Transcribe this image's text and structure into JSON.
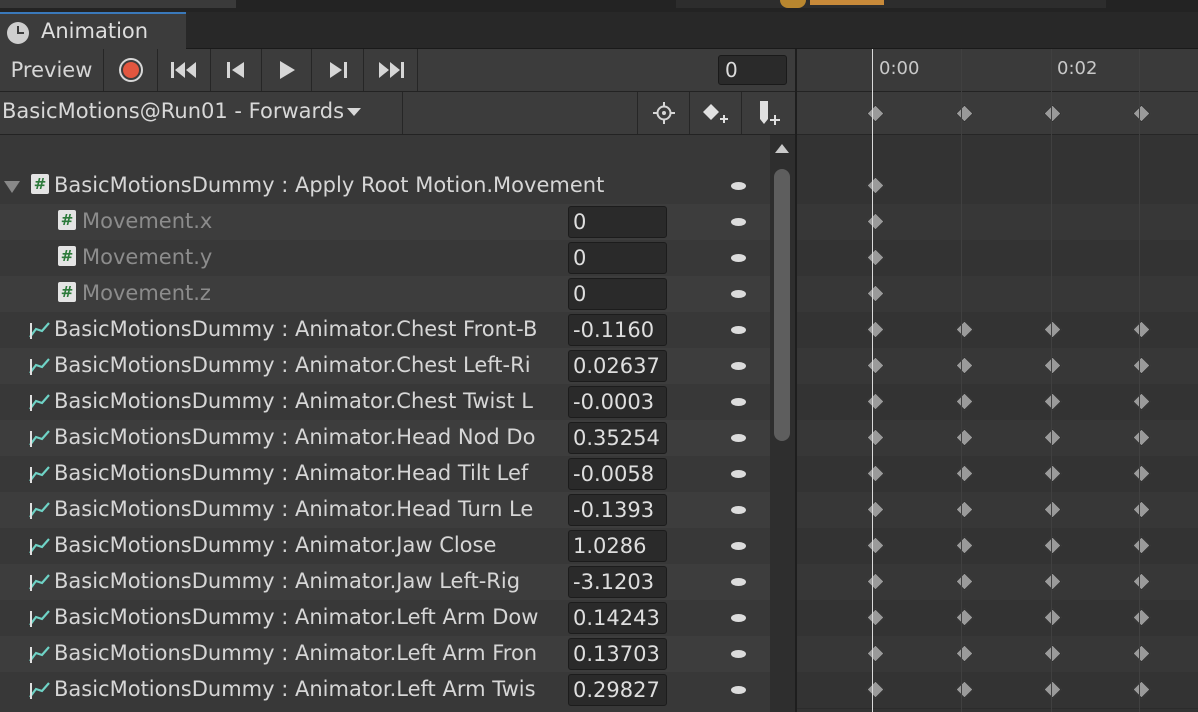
{
  "window": {
    "tab_label": "Animation"
  },
  "toolbar": {
    "preview_label": "Preview",
    "frame_value": "0",
    "record_color": "#e2563f"
  },
  "clip": {
    "name": "BasicMotions@Run01 - Forwards"
  },
  "timeline": {
    "ruler_labels": [
      "0:00",
      "0:02"
    ]
  },
  "properties": [
    {
      "name": "BasicMotionsDummy : Apply Root Motion.Movement",
      "value": "",
      "kind": "hash-parent",
      "keys": [
        0
      ]
    },
    {
      "name": "Movement.x",
      "value": "0",
      "kind": "hash-child",
      "keys": [
        0
      ]
    },
    {
      "name": "Movement.y",
      "value": "0",
      "kind": "hash-child",
      "keys": [
        0
      ]
    },
    {
      "name": "Movement.z",
      "value": "0",
      "kind": "hash-child",
      "keys": [
        0
      ]
    },
    {
      "name": "BasicMotionsDummy : Animator.Chest Front-B",
      "value": "-0.1160",
      "kind": "curve",
      "keys": [
        0,
        1,
        2,
        3
      ]
    },
    {
      "name": "BasicMotionsDummy : Animator.Chest Left-Ri",
      "value": "0.02637",
      "kind": "curve",
      "keys": [
        0,
        1,
        2,
        3
      ]
    },
    {
      "name": "BasicMotionsDummy : Animator.Chest Twist L",
      "value": "-0.0003",
      "kind": "curve",
      "keys": [
        0,
        1,
        2,
        3
      ]
    },
    {
      "name": "BasicMotionsDummy : Animator.Head Nod Do",
      "value": "0.35254",
      "kind": "curve",
      "keys": [
        0,
        1,
        2,
        3
      ]
    },
    {
      "name": "BasicMotionsDummy : Animator.Head Tilt Lef",
      "value": "-0.0058",
      "kind": "curve",
      "keys": [
        0,
        1,
        2,
        3
      ]
    },
    {
      "name": "BasicMotionsDummy : Animator.Head Turn Le",
      "value": "-0.1393",
      "kind": "curve",
      "keys": [
        0,
        1,
        2,
        3
      ]
    },
    {
      "name": "BasicMotionsDummy : Animator.Jaw Close",
      "value": "1.0286",
      "kind": "curve",
      "keys": [
        0,
        1,
        2,
        3
      ]
    },
    {
      "name": "BasicMotionsDummy : Animator.Jaw Left-Rig",
      "value": "-3.1203",
      "kind": "curve",
      "keys": [
        0,
        1,
        2,
        3
      ]
    },
    {
      "name": "BasicMotionsDummy : Animator.Left Arm Dow",
      "value": "0.14243",
      "kind": "curve",
      "keys": [
        0,
        1,
        2,
        3
      ]
    },
    {
      "name": "BasicMotionsDummy : Animator.Left Arm Fron",
      "value": "0.13703",
      "kind": "curve",
      "keys": [
        0,
        1,
        2,
        3
      ]
    },
    {
      "name": "BasicMotionsDummy : Animator.Left Arm Twis",
      "value": "0.29827",
      "kind": "curve",
      "keys": [
        0,
        1,
        2,
        3
      ]
    }
  ]
}
